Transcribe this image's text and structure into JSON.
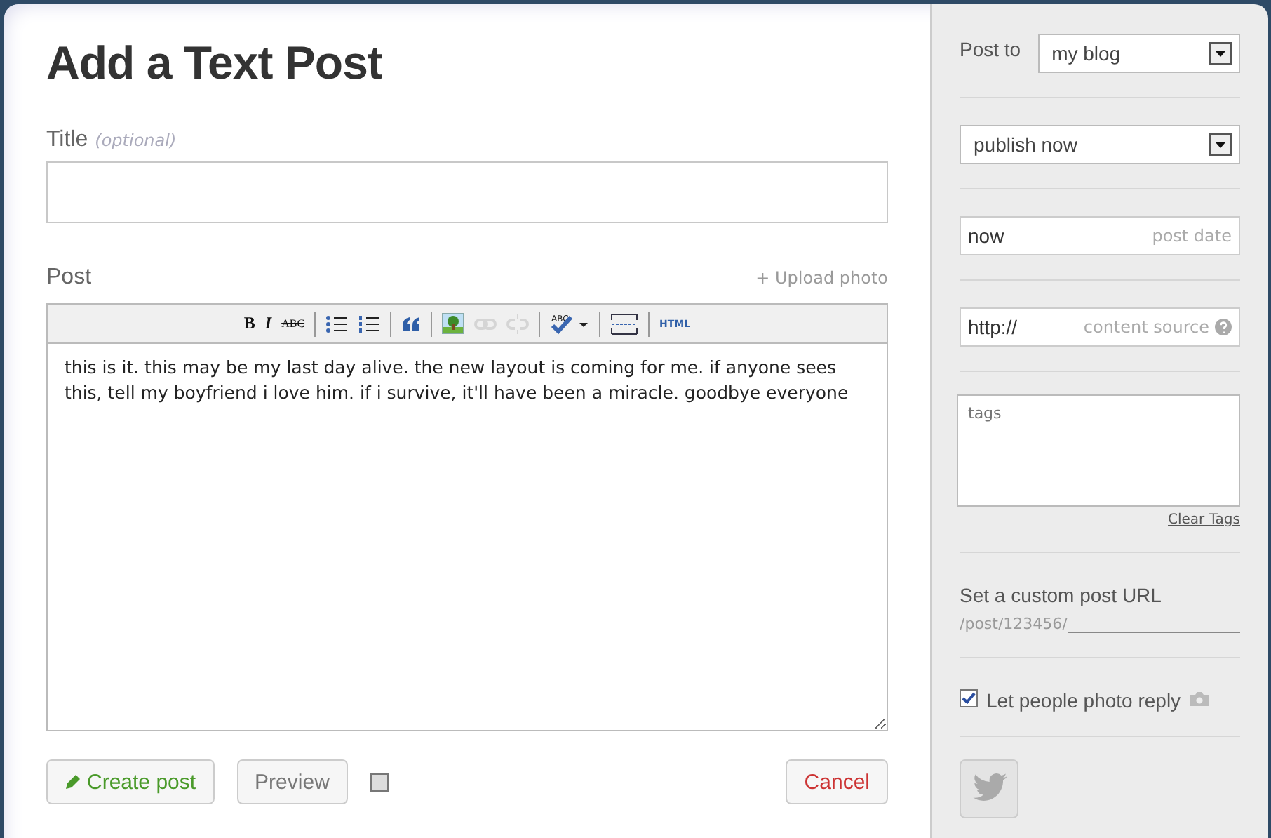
{
  "heading": "Add a Text Post",
  "title_field": {
    "label": "Title",
    "hint": "(optional)"
  },
  "post": {
    "label": "Post",
    "upload_link": "+ Upload photo",
    "body": "this is it. this may be my last day alive. the new layout is coming for me. if anyone sees this, tell my boyfriend i love him. if i survive, it'll have been a miracle. goodbye everyone"
  },
  "toolbar": [
    {
      "kind": "bold",
      "label": "B",
      "disabled": false
    },
    {
      "kind": "italic",
      "label": "I",
      "disabled": false
    },
    {
      "kind": "strike",
      "label": "ABC",
      "disabled": false
    },
    {
      "kind": "sep"
    },
    {
      "kind": "bullets",
      "disabled": false
    },
    {
      "kind": "numbers",
      "disabled": false
    },
    {
      "kind": "sep"
    },
    {
      "kind": "quote",
      "disabled": false
    },
    {
      "kind": "sep"
    },
    {
      "kind": "image",
      "disabled": false
    },
    {
      "kind": "link",
      "disabled": true
    },
    {
      "kind": "unlink",
      "disabled": true
    },
    {
      "kind": "sep"
    },
    {
      "kind": "spell",
      "label": "ABC",
      "disabled": false
    },
    {
      "kind": "sep"
    },
    {
      "kind": "pagebreak",
      "disabled": false
    },
    {
      "kind": "sep"
    },
    {
      "kind": "html",
      "label": "HTML",
      "disabled": false
    }
  ],
  "actions": {
    "create": "Create post",
    "preview": "Preview",
    "option_checked": false,
    "cancel": "Cancel"
  },
  "sidebar": {
    "post_to": {
      "label": "Post to",
      "value": "my blog"
    },
    "publish": {
      "value": "publish now"
    },
    "date": {
      "value": "now",
      "hint": "post date"
    },
    "source": {
      "value": "http://",
      "hint": "content source"
    },
    "tags": {
      "placeholder": "tags",
      "clear": "Clear Tags"
    },
    "custom_url": {
      "label": "Set a custom post URL",
      "prefix": "/post/123456/"
    },
    "photo_reply": {
      "label": "Let people photo reply",
      "checked": true
    }
  }
}
